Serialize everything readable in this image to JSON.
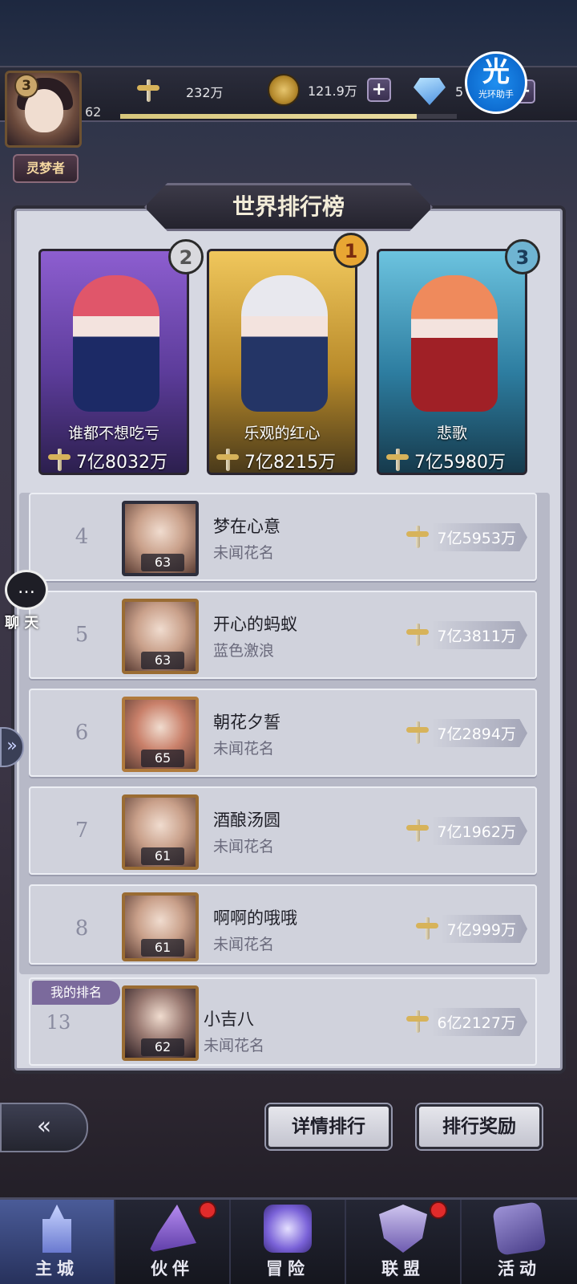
{
  "player": {
    "level": "62",
    "vip": "3",
    "title": "灵梦者"
  },
  "resources": {
    "power": "232万",
    "gold": "121.9万",
    "gems": "5"
  },
  "xp_progress": 0.88,
  "helper_badge": {
    "big": "光",
    "small": "光环助手"
  },
  "page_title": "世界排行榜",
  "top3": [
    {
      "rank": "2",
      "name": "谁都不想吃亏",
      "score": "7亿8032万"
    },
    {
      "rank": "1",
      "name": "乐观的红心",
      "score": "7亿8215万"
    },
    {
      "rank": "3",
      "name": "悲歌",
      "score": "7亿5980万"
    }
  ],
  "rows": [
    {
      "rank": "4",
      "name": "梦在心意",
      "guild": "未闻花名",
      "level": "63",
      "score": "7亿5953万"
    },
    {
      "rank": "5",
      "name": "开心的蚂蚁",
      "guild": "蓝色激浪",
      "level": "63",
      "score": "7亿3811万"
    },
    {
      "rank": "6",
      "name": "朝花夕誓",
      "guild": "未闻花名",
      "level": "65",
      "score": "7亿2894万"
    },
    {
      "rank": "7",
      "name": "酒酿汤圆",
      "guild": "未闻花名",
      "level": "61",
      "score": "7亿1962万"
    },
    {
      "rank": "8",
      "name": "啊啊的哦哦",
      "guild": "未闻花名",
      "level": "61",
      "score": "7亿999万"
    }
  ],
  "my_rank": {
    "tag": "我的排名",
    "rank": "13",
    "name": "小吉八",
    "guild": "未闻花名",
    "level": "62",
    "score": "6亿2127万"
  },
  "chat_label": "聊 天",
  "buttons": {
    "detail": "详情排行",
    "reward": "排行奖励"
  },
  "nav": [
    {
      "label": "主城",
      "icon": "castle-icon",
      "badge": false
    },
    {
      "label": "伙伴",
      "icon": "witch-hat-icon",
      "badge": true
    },
    {
      "label": "冒险",
      "icon": "portal-orb-icon",
      "badge": false
    },
    {
      "label": "联盟",
      "icon": "shield-icon",
      "badge": true
    },
    {
      "label": "活动",
      "icon": "cards-icon",
      "badge": false
    }
  ]
}
